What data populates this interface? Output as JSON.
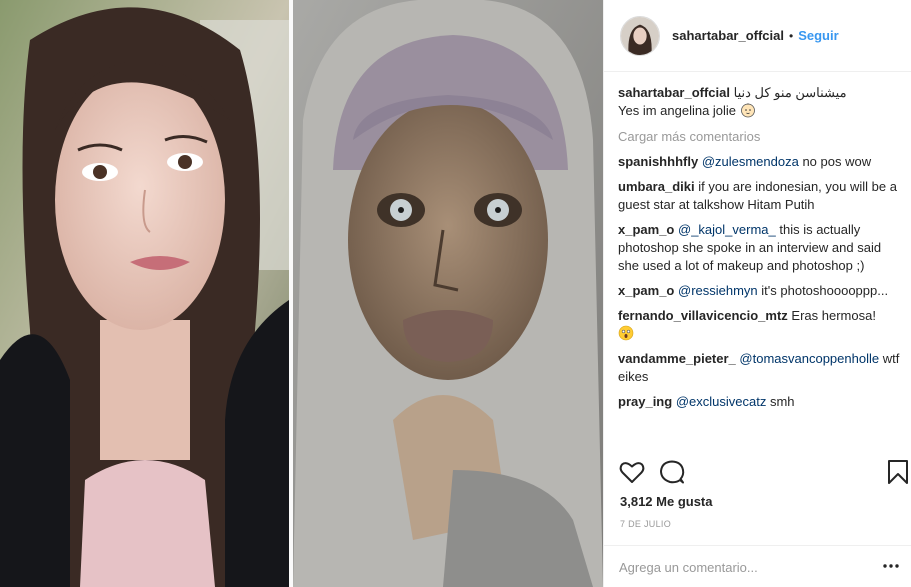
{
  "post": {
    "images": [
      {
        "name": "left-portrait",
        "description_icon": "photo-icon"
      },
      {
        "name": "right-portrait",
        "description_icon": "photo-icon"
      }
    ]
  },
  "header": {
    "username": "sahartabar_offcial",
    "separator": "•",
    "follow_label": "Seguir"
  },
  "caption": {
    "username": "sahartabar_offcial",
    "text_line1": "میشناسن منو کل دنیا",
    "text_line2": "Yes im angelina jolie"
  },
  "load_more_label": "Cargar más comentarios",
  "comments": [
    {
      "user": "spanishhhfly",
      "mention": "@zulesmendoza",
      "text": " no pos wow"
    },
    {
      "user": "umbara_diki",
      "mention": "",
      "text": " if you are indonesian, you will be a guest star at talkshow Hitam Putih"
    },
    {
      "user": "x_pam_o",
      "mention": "@_kajol_verma_",
      "text": " this is actually photoshop she spoke in an interview and said she used a lot of makeup and photoshop ;)"
    },
    {
      "user": "x_pam_o",
      "mention": "@ressiehmyn",
      "text": " it's photoshooooppp..."
    },
    {
      "user": "fernando_villavicencio_mtz",
      "mention": "",
      "text": " Eras hermosa!"
    },
    {
      "user": "vandamme_pieter_",
      "mention": "@tomasvancoppenholle",
      "text": " wtf eikes"
    },
    {
      "user": "pray_ing",
      "mention": "@exclusivecatz",
      "text": " smh"
    }
  ],
  "actions": {
    "like_icon": "heart-icon",
    "comment_icon": "comment-bubble-icon",
    "save_icon": "bookmark-icon"
  },
  "likes_text": "3,812 Me gusta",
  "date_text": "7 DE JULIO",
  "add_comment": {
    "placeholder": "Agrega un comentario...",
    "more_icon": "more-options-icon"
  },
  "colors": {
    "link": "#3897f0",
    "mention": "#003569",
    "muted": "#999999",
    "text": "#262626"
  }
}
